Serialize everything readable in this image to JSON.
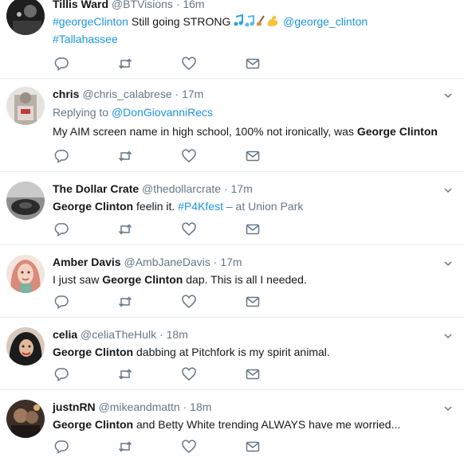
{
  "tweets": [
    {
      "name": "Tillis Ward",
      "handle": "@BTVisions",
      "dot": "·",
      "time": "16m",
      "body": {
        "t1": "#georgeClinton",
        "t2": " Still going STRONG ",
        "t3": "@george_clinton",
        "t4": "#Tallahassee"
      }
    },
    {
      "name": "chris",
      "handle": "@chris_calabrese",
      "dot": "·",
      "time": "17m",
      "replying_prefix": "Replying to ",
      "replying_to": "@DonGiovanniRecs",
      "body": {
        "t1": "My AIM screen name in high school, 100% not ironically, was ",
        "t2": "George Clinton"
      }
    },
    {
      "name": "The Dollar Crate",
      "handle": "@thedollarcrate",
      "dot": "·",
      "time": "17m",
      "body": {
        "t1": "George Clinton",
        "t2": " feelin it. ",
        "t3": "#P4Kfest",
        "t4": " – at Union Park"
      }
    },
    {
      "name": "Amber Davis",
      "handle": "@AmbJaneDavis",
      "dot": "·",
      "time": "17m",
      "body": {
        "t1": "I just saw ",
        "t2": "George Clinton",
        "t3": " dap. This is all I needed."
      }
    },
    {
      "name": "celia",
      "handle": "@celiaTheHulk",
      "dot": "·",
      "time": "18m",
      "body": {
        "t1": "George Clinton",
        "t2": " dabbing at Pitchfork is my spirit animal."
      }
    },
    {
      "name": "justnRN",
      "handle": "@mikeandmattn",
      "dot": "·",
      "time": "18m",
      "body": {
        "t1": "George Clinton",
        "t2": " and Betty White trending ALWAYS have me worried..."
      }
    }
  ],
  "icons": {
    "reply": "reply-icon",
    "retweet": "retweet-icon",
    "like": "heart-icon",
    "message": "envelope-icon",
    "caret": "chevron-down-icon"
  },
  "colors": {
    "link": "#1b95e0",
    "secondary_text": "#657786",
    "icon": "#657786",
    "divider": "#e6ecf0"
  }
}
